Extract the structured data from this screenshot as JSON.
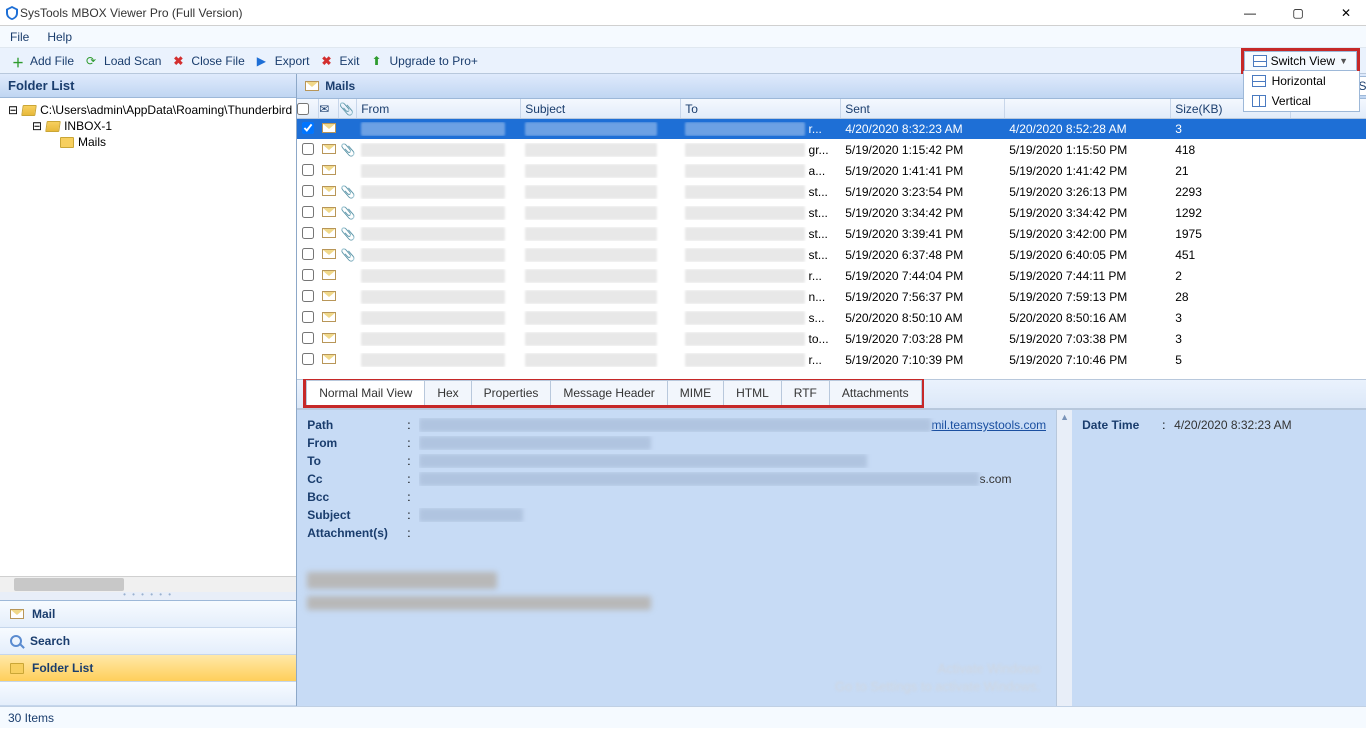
{
  "window": {
    "title": "SysTools MBOX Viewer Pro (Full Version)"
  },
  "menu": {
    "file": "File",
    "help": "Help"
  },
  "toolbar": {
    "add_file": "Add File",
    "load_scan": "Load Scan",
    "close_file": "Close File",
    "export": "Export",
    "exit": "Exit",
    "upgrade": "Upgrade to Pro+",
    "switch_view": "Switch View",
    "switch_menu": {
      "horizontal": "Horizontal",
      "vertical": "Vertical"
    }
  },
  "folder_panel": {
    "title": "Folder List",
    "nodes": {
      "root": "C:\\Users\\admin\\AppData\\Roaming\\Thunderbird",
      "inbox": "INBOX-1",
      "mails": "Mails"
    }
  },
  "nav": {
    "mail": "Mail",
    "search": "Search",
    "folder_list": "Folder List"
  },
  "mails_header": {
    "title": "Mails",
    "export_selected": "Export Selected"
  },
  "columns": {
    "from": "From",
    "subject": "Subject",
    "to": "To",
    "sent": "Sent",
    "received": "",
    "size": "Size(KB)"
  },
  "rows": [
    {
      "to_suffix": "r...",
      "sent": "4/20/2020 8:32:23 AM",
      "received": "4/20/2020 8:52:28 AM",
      "size": "3",
      "clip": false,
      "selected": true
    },
    {
      "to_suffix": "gr...",
      "sent": "5/19/2020 1:15:42 PM",
      "received": "5/19/2020 1:15:50 PM",
      "size": "418",
      "clip": true
    },
    {
      "to_suffix": "a...",
      "sent": "5/19/2020 1:41:41 PM",
      "received": "5/19/2020 1:41:42 PM",
      "size": "21",
      "clip": false
    },
    {
      "to_suffix": "st...",
      "sent": "5/19/2020 3:23:54 PM",
      "received": "5/19/2020 3:26:13 PM",
      "size": "2293",
      "clip": true
    },
    {
      "to_suffix": "st...",
      "sent": "5/19/2020 3:34:42 PM",
      "received": "5/19/2020 3:34:42 PM",
      "size": "1292",
      "clip": true
    },
    {
      "to_suffix": "st...",
      "sent": "5/19/2020 3:39:41 PM",
      "received": "5/19/2020 3:42:00 PM",
      "size": "1975",
      "clip": true
    },
    {
      "to_suffix": "st...",
      "sent": "5/19/2020 6:37:48 PM",
      "received": "5/19/2020 6:40:05 PM",
      "size": "451",
      "clip": true
    },
    {
      "to_suffix": "r...",
      "sent": "5/19/2020 7:44:04 PM",
      "received": "5/19/2020 7:44:11 PM",
      "size": "2",
      "clip": false
    },
    {
      "to_suffix": "n...",
      "sent": "5/19/2020 7:56:37 PM",
      "received": "5/19/2020 7:59:13 PM",
      "size": "28",
      "clip": false
    },
    {
      "to_suffix": "s...",
      "sent": "5/20/2020 8:50:10 AM",
      "received": "5/20/2020 8:50:16 AM",
      "size": "3",
      "clip": false
    },
    {
      "to_suffix": "to...",
      "sent": "5/19/2020 7:03:28 PM",
      "received": "5/19/2020 7:03:38 PM",
      "size": "3",
      "clip": false
    },
    {
      "to_suffix": "r...",
      "sent": "5/19/2020 7:10:39 PM",
      "received": "5/19/2020 7:10:46 PM",
      "size": "5",
      "clip": false
    }
  ],
  "tabs": {
    "normal": "Normal Mail View",
    "hex": "Hex",
    "properties": "Properties",
    "msgheader": "Message Header",
    "mime": "MIME",
    "html": "HTML",
    "rtf": "RTF",
    "attachments": "Attachments"
  },
  "preview": {
    "path_label": "Path",
    "path_suffix": "mil.teamsystools.com",
    "from_label": "From",
    "to_label": "To",
    "cc_label": "Cc",
    "cc_suffix": "s.com",
    "bcc_label": "Bcc",
    "subject_label": "Subject",
    "attachments_label": "Attachment(s)",
    "datetime_label": "Date Time",
    "datetime_value": "4/20/2020 8:32:23 AM"
  },
  "status": {
    "items": "30 Items"
  }
}
